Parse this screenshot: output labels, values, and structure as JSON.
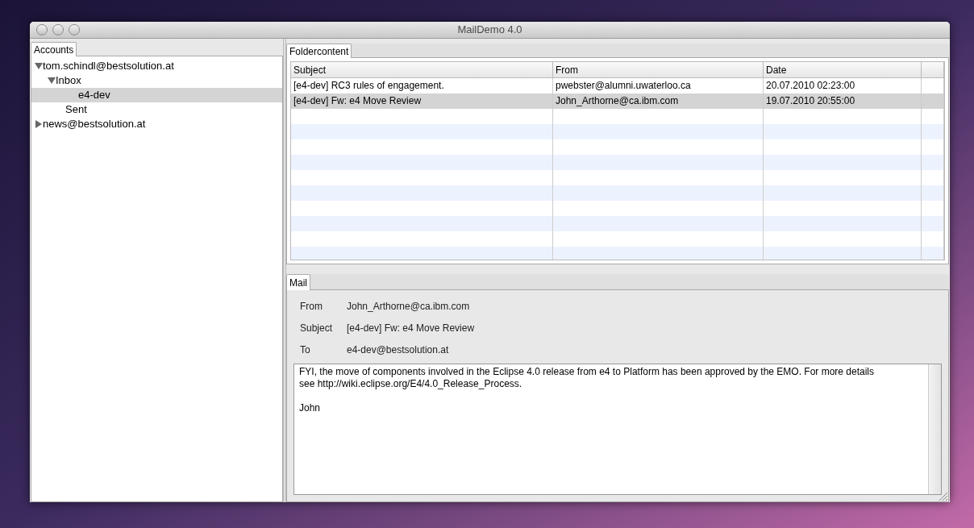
{
  "window": {
    "title": "MailDemo 4.0"
  },
  "accounts": {
    "tab": "Accounts",
    "tree": [
      {
        "label": "tom.schindl@bestsolution.at",
        "expanded": true,
        "selected": false,
        "children": [
          {
            "label": "Inbox",
            "expanded": true,
            "selected": false,
            "children": [
              {
                "label": "e4-dev",
                "selected": true
              }
            ]
          },
          {
            "label": "Sent",
            "selected": false
          }
        ]
      },
      {
        "label": "news@bestsolution.at",
        "expanded": false,
        "selected": false
      }
    ]
  },
  "folder_content": {
    "tab": "Foldercontent",
    "columns": [
      "Subject",
      "From",
      "Date"
    ],
    "rows": [
      {
        "subject": "[e4-dev] RC3 rules of engagement.",
        "from": "pwebster@alumni.uwaterloo.ca",
        "date": "20.07.2010 02:23:00",
        "selected": false
      },
      {
        "subject": "[e4-dev] Fw: e4 Move Review",
        "from": "John_Arthorne@ca.ibm.com",
        "date": "19.07.2010 20:55:00",
        "selected": true
      }
    ]
  },
  "mail": {
    "tab": "Mail",
    "fields": [
      {
        "label": "From",
        "value": "John_Arthorne@ca.ibm.com"
      },
      {
        "label": "Subject",
        "value": "[e4-dev] Fw: e4 Move Review"
      },
      {
        "label": "To",
        "value": "e4-dev@bestsolution.at"
      }
    ],
    "body": [
      "FYI, the move of components involved in the Eclipse 4.0 release from e4 to Platform has been approved by the EMO. For more details see http://wiki.eclipse.org/E4/4.0_Release_Process.",
      "John"
    ]
  }
}
